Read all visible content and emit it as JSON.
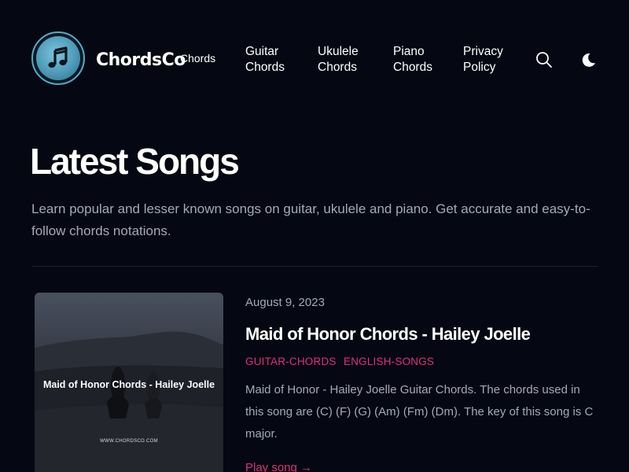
{
  "header": {
    "brand": "ChordsCo",
    "brand_sup": "Chords",
    "nav": [
      {
        "line1": "Guitar",
        "line2": "Chords"
      },
      {
        "line1": "Ukulele",
        "line2": "Chords"
      },
      {
        "line1": "Piano",
        "line2": "Chords"
      },
      {
        "line1": "Privacy",
        "line2": "Policy"
      }
    ],
    "icons": {
      "search": "search-icon",
      "theme": "moon-icon",
      "logo": "music-note-icon"
    }
  },
  "hero": {
    "title": "Latest Songs",
    "description": "Learn popular and lesser known songs on guitar, ukulele and piano. Get accurate and easy-to-follow chords notations."
  },
  "post": {
    "thumbnail_title": "Maid of Honor Chords - Hailey Joelle",
    "thumbnail_url": "WWW.CHORDSCO.COM",
    "date": "August 9, 2023",
    "title": "Maid of Honor Chords - Hailey Joelle",
    "tags": [
      "GUITAR-CHORDS",
      "ENGLISH-SONGS"
    ],
    "excerpt": "Maid of Honor - Hailey Joelle Guitar Chords. The chords used in this song are (C) (F) (G) (Am) (Fm) (Dm). The key of this song is C major.",
    "link": "Play song →"
  },
  "colors": {
    "background": "#050812",
    "accent": "#e0317a",
    "muted_text": "#a3a9b8",
    "logo_ring": "#5aa9c8"
  }
}
